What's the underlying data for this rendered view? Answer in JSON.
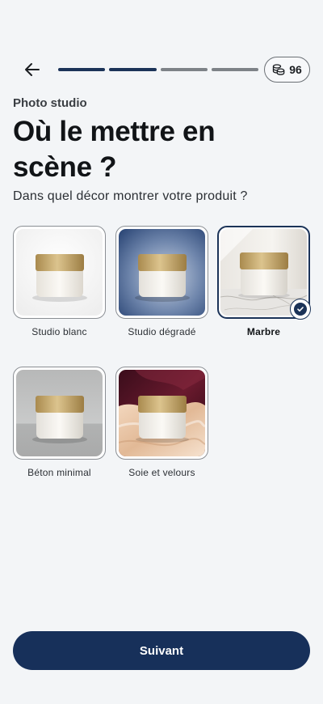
{
  "header": {
    "back_icon": "arrow-left-icon",
    "progress": {
      "total_steps": 4,
      "completed_steps": 2
    },
    "credits": {
      "icon": "coins-icon",
      "value": "96"
    }
  },
  "page": {
    "eyebrow": "Photo studio",
    "title": "Où le mettre en scène ?",
    "subtitle": "Dans quel décor montrer votre produit ?"
  },
  "options": [
    {
      "label": "Studio blanc",
      "selected": false
    },
    {
      "label": "Studio dégradé",
      "selected": false
    },
    {
      "label": "Marbre",
      "selected": true
    },
    {
      "label": "Béton minimal",
      "selected": false
    },
    {
      "label": "Soie et velours",
      "selected": false
    }
  ],
  "footer": {
    "next_label": "Suivant"
  },
  "colors": {
    "primary": "#17305a",
    "background": "#f3f5f7",
    "gold_lid": "#c7a866"
  }
}
